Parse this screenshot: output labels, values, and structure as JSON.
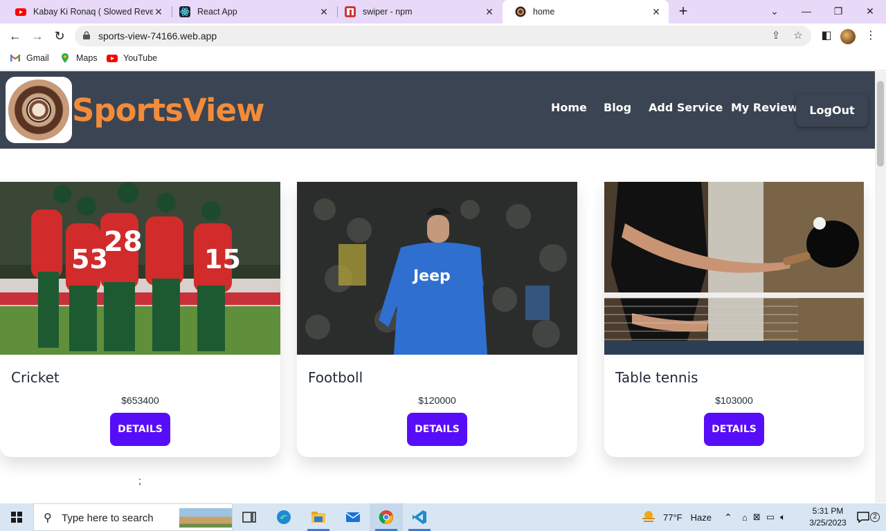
{
  "browser": {
    "tabs": [
      {
        "label": "Kabay Ki Ronaq ( Slowed Reverb",
        "icon": "youtube-icon",
        "active": false
      },
      {
        "label": "React App",
        "icon": "react-icon",
        "active": false
      },
      {
        "label": "swiper - npm",
        "icon": "npm-icon",
        "active": false
      },
      {
        "label": "home",
        "icon": "site-logo-icon",
        "active": true
      }
    ],
    "close_glyph": "✕",
    "new_tab_glyph": "+",
    "url": "sports-view-74166.web.app",
    "bookmarks": [
      {
        "label": "Gmail",
        "icon": "gmail-icon"
      },
      {
        "label": "Maps",
        "icon": "maps-icon"
      },
      {
        "label": "YouTube",
        "icon": "youtube-icon"
      }
    ]
  },
  "site": {
    "brand": "SportsView",
    "nav": {
      "home": "Home",
      "blog": "Blog",
      "add_service": "Add Service",
      "my_review": "My Review",
      "logout": "LogOut"
    },
    "services": [
      {
        "title": "Cricket",
        "price": "$653400",
        "button": "DETAILS"
      },
      {
        "title": "Footboll",
        "price": "$120000",
        "button": "DETAILS"
      },
      {
        "title": "Table tennis",
        "price": "$103000",
        "button": "DETAILS"
      }
    ],
    "stray_text": ";"
  },
  "colors": {
    "header_bg": "#3b4452",
    "brand_orange": "#f28c3a",
    "button_purple": "#570df8",
    "tabstrip_bg": "#e7d9f7"
  },
  "taskbar": {
    "search_placeholder": "Type here to search",
    "weather": "77°F",
    "weather_desc": "Haze",
    "time": "5:31 PM",
    "date": "3/25/2023",
    "notifications": "2"
  }
}
